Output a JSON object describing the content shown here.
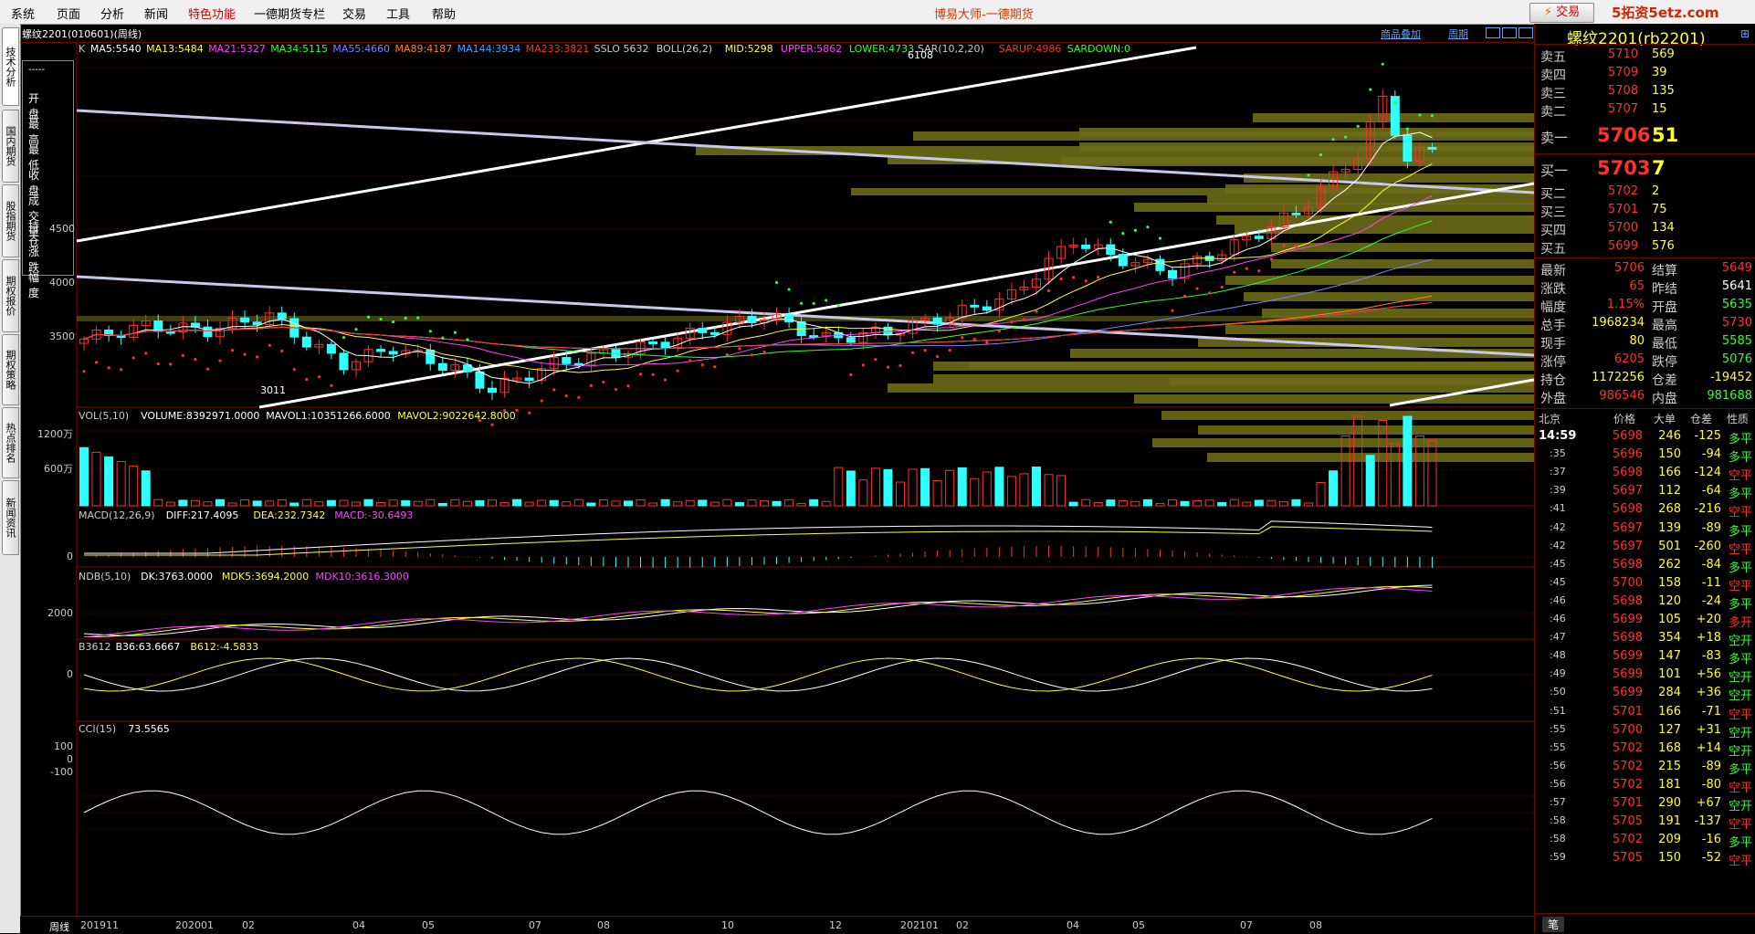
{
  "menu": [
    {
      "label": "系统",
      "red": false
    },
    {
      "label": "页面",
      "red": false
    },
    {
      "label": "分析",
      "red": false
    },
    {
      "label": "新闻",
      "red": false
    },
    {
      "label": "特色功能",
      "red": true
    },
    {
      "label": "一德期货专栏",
      "red": false
    },
    {
      "label": "交易",
      "red": false
    },
    {
      "label": "工具",
      "red": false
    },
    {
      "label": "帮助",
      "red": false
    }
  ],
  "app_title": "博易大师-一德期货",
  "trade_button": "交易",
  "watermark": "5拓资5etz.com",
  "left_tabs": [
    "技术分析",
    "国内期货",
    "股指期货",
    "期权报价",
    "期权策略",
    "热点排名",
    "新闻资讯"
  ],
  "chart_header": {
    "symbol": "螺纹2201(010601)(周线)",
    "buttons": [
      "商品叠加",
      "周期"
    ]
  },
  "indicators": [
    {
      "text": "K",
      "color": "#cccccc"
    },
    {
      "text": "MA5:5540",
      "color": "#ffffff"
    },
    {
      "text": "MA13:5484",
      "color": "#ffff30"
    },
    {
      "text": "MA21:5327",
      "color": "#ff40ff"
    },
    {
      "text": "MA34:5115",
      "color": "#30ff30"
    },
    {
      "text": "MA55:4660",
      "color": "#8080ff"
    },
    {
      "text": "MA89:4187",
      "color": "#ff8020"
    },
    {
      "text": "MA144:3934",
      "color": "#40a0ff"
    },
    {
      "text": "MA233:3821",
      "color": "#ff3030"
    },
    {
      "text": "SSLO 5632",
      "color": "#cccccc"
    },
    {
      "text": "BOLL(26,2)",
      "color": "#cccccc"
    },
    {
      "text": "MID:5298",
      "color": "#ffff30"
    },
    {
      "text": "UPPER:5862",
      "color": "#ff40ff"
    },
    {
      "text": "LOWER:4733",
      "color": "#30ff30"
    },
    {
      "text": "SAR(10,2,20)",
      "color": "#cccccc"
    },
    {
      "text": "SARUP:4986",
      "color": "#ff3030"
    },
    {
      "text": "SARDOWN:0",
      "color": "#30ff30"
    }
  ],
  "ohlc_box": [
    "-----",
    "开 盘",
    "最 高",
    "最 低",
    "收 盘",
    "成交量",
    "持 仓",
    "涨 跌",
    "幅 度"
  ],
  "price_axis": [
    "4500",
    "4000",
    "3500"
  ],
  "price_annotations": {
    "high": "6108",
    "low": "3011"
  },
  "panels": {
    "vol": {
      "title_parts": [
        {
          "t": "VOL(5,10)",
          "c": "#cccccc"
        },
        {
          "t": "VOLUME:8392971.0000",
          "c": "#ffffff"
        },
        {
          "t": "MAVOL1:10351266.6000",
          "c": "#ffffff"
        },
        {
          "t": "MAVOL2:9022642.8000",
          "c": "#ffff30"
        }
      ],
      "axis": [
        "1200万",
        "600万"
      ]
    },
    "macd": {
      "title_parts": [
        {
          "t": "MACD(12,26,9)",
          "c": "#cccccc"
        },
        {
          "t": "DIFF:217.4095",
          "c": "#ffffff"
        },
        {
          "t": "DEA:232.7342",
          "c": "#ffff30"
        },
        {
          "t": "MACD:-30.6493",
          "c": "#ff40ff"
        }
      ],
      "axis": [
        "0"
      ]
    },
    "ndb": {
      "title_parts": [
        {
          "t": "NDB(5,10)",
          "c": "#cccccc"
        },
        {
          "t": "DK:3763.0000",
          "c": "#ffffff"
        },
        {
          "t": "MDK5:3694.2000",
          "c": "#ffff30"
        },
        {
          "t": "MDK10:3616.3000",
          "c": "#ff40ff"
        }
      ],
      "axis": [
        "2000"
      ]
    },
    "b3612": {
      "title_parts": [
        {
          "t": "B3612",
          "c": "#cccccc"
        },
        {
          "t": "B36:63.6667",
          "c": "#ffffff"
        },
        {
          "t": "B612:-4.5833",
          "c": "#ffff30"
        }
      ],
      "axis": [
        "0"
      ]
    },
    "cci": {
      "title_parts": [
        {
          "t": "CCI(15)",
          "c": "#cccccc"
        },
        {
          "t": "73.5565",
          "c": "#ffffff"
        }
      ],
      "axis": [
        "100",
        "0",
        "-100"
      ]
    }
  },
  "x_axis": {
    "period_label": "周线",
    "labels": [
      "201911",
      "202001",
      "02",
      "04",
      "05",
      "07",
      "08",
      "10",
      "12",
      "202101",
      "02",
      "04",
      "05",
      "07",
      "08"
    ]
  },
  "quote": {
    "title": "螺纹2201(rb2201)",
    "asks": [
      {
        "label": "卖五",
        "price": "5710",
        "vol": "569"
      },
      {
        "label": "卖四",
        "price": "5709",
        "vol": "39"
      },
      {
        "label": "卖三",
        "price": "5708",
        "vol": "135"
      },
      {
        "label": "卖二",
        "price": "5707",
        "vol": "15"
      },
      {
        "label": "卖一",
        "price": "5706",
        "vol": "51"
      }
    ],
    "bids": [
      {
        "label": "买一",
        "price": "5703",
        "vol": "7"
      },
      {
        "label": "买二",
        "price": "5702",
        "vol": "2"
      },
      {
        "label": "买三",
        "price": "5701",
        "vol": "75"
      },
      {
        "label": "买四",
        "price": "5700",
        "vol": "134"
      },
      {
        "label": "买五",
        "price": "5699",
        "vol": "576"
      }
    ],
    "stats": [
      {
        "l1": "最新",
        "v1": "5706",
        "c1": "red",
        "l2": "结算",
        "v2": "5649",
        "c2": "red"
      },
      {
        "l1": "涨跌",
        "v1": "65",
        "c1": "red",
        "l2": "昨结",
        "v2": "5641",
        "c2": "wht"
      },
      {
        "l1": "幅度",
        "v1": "1.15%",
        "c1": "red",
        "l2": "开盘",
        "v2": "5635",
        "c2": "grn"
      },
      {
        "l1": "总手",
        "v1": "1968234",
        "c1": "yel",
        "l2": "最高",
        "v2": "5730",
        "c2": "red"
      },
      {
        "l1": "现手",
        "v1": "80",
        "c1": "yel",
        "l2": "最低",
        "v2": "5585",
        "c2": "grn"
      },
      {
        "l1": "涨停",
        "v1": "6205",
        "c1": "red",
        "l2": "跌停",
        "v2": "5076",
        "c2": "grn"
      },
      {
        "l1": "持仓",
        "v1": "1172256",
        "c1": "yel",
        "l2": "仓差",
        "v2": "-19452",
        "c2": "yel"
      },
      {
        "l1": "外盘",
        "v1": "986546",
        "c1": "red",
        "l2": "内盘",
        "v2": "981688",
        "c2": "grn"
      }
    ],
    "tick_header": [
      "北京",
      "价格",
      "大单",
      "仓差",
      "性质"
    ],
    "ticks": [
      {
        "t": "14:59",
        "p": "5698",
        "v": "246",
        "d": "-125",
        "n": "多平",
        "nc": "grn"
      },
      {
        "t": ":35",
        "p": "5696",
        "v": "150",
        "d": "-94",
        "n": "多平",
        "nc": "grn"
      },
      {
        "t": ":37",
        "p": "5698",
        "v": "166",
        "d": "-124",
        "n": "空平",
        "nc": "red"
      },
      {
        "t": ":39",
        "p": "5697",
        "v": "112",
        "d": "-64",
        "n": "多平",
        "nc": "grn"
      },
      {
        "t": ":41",
        "p": "5698",
        "v": "268",
        "d": "-216",
        "n": "空平",
        "nc": "red"
      },
      {
        "t": ":42",
        "p": "5697",
        "v": "139",
        "d": "-89",
        "n": "多平",
        "nc": "grn"
      },
      {
        "t": ":42",
        "p": "5697",
        "v": "501",
        "d": "-260",
        "n": "空平",
        "nc": "red"
      },
      {
        "t": ":45",
        "p": "5698",
        "v": "262",
        "d": "-84",
        "n": "多平",
        "nc": "grn"
      },
      {
        "t": ":45",
        "p": "5700",
        "v": "158",
        "d": "-11",
        "n": "空平",
        "nc": "red"
      },
      {
        "t": ":46",
        "p": "5698",
        "v": "120",
        "d": "-24",
        "n": "多平",
        "nc": "grn"
      },
      {
        "t": ":46",
        "p": "5699",
        "v": "105",
        "d": "+20",
        "n": "多开",
        "nc": "red"
      },
      {
        "t": ":47",
        "p": "5698",
        "v": "354",
        "d": "+18",
        "n": "空开",
        "nc": "grn"
      },
      {
        "t": ":48",
        "p": "5699",
        "v": "147",
        "d": "-83",
        "n": "多平",
        "nc": "grn"
      },
      {
        "t": ":49",
        "p": "5699",
        "v": "101",
        "d": "+56",
        "n": "空开",
        "nc": "grn"
      },
      {
        "t": ":50",
        "p": "5699",
        "v": "284",
        "d": "+36",
        "n": "空开",
        "nc": "grn"
      },
      {
        "t": ":51",
        "p": "5701",
        "v": "166",
        "d": "-71",
        "n": "空平",
        "nc": "red"
      },
      {
        "t": ":55",
        "p": "5700",
        "v": "127",
        "d": "+31",
        "n": "空开",
        "nc": "grn"
      },
      {
        "t": ":55",
        "p": "5702",
        "v": "168",
        "d": "+14",
        "n": "空开",
        "nc": "grn"
      },
      {
        "t": ":56",
        "p": "5702",
        "v": "215",
        "d": "-89",
        "n": "多平",
        "nc": "grn"
      },
      {
        "t": ":56",
        "p": "5702",
        "v": "181",
        "d": "-80",
        "n": "空平",
        "nc": "red"
      },
      {
        "t": ":57",
        "p": "5701",
        "v": "290",
        "d": "+67",
        "n": "空开",
        "nc": "grn"
      },
      {
        "t": ":58",
        "p": "5705",
        "v": "191",
        "d": "-137",
        "n": "空平",
        "nc": "red"
      },
      {
        "t": ":58",
        "p": "5702",
        "v": "209",
        "d": "-16",
        "n": "多平",
        "nc": "grn"
      },
      {
        "t": ":59",
        "p": "5705",
        "v": "150",
        "d": "-52",
        "n": "空平",
        "nc": "red"
      }
    ],
    "footer_tab": "笔"
  }
}
